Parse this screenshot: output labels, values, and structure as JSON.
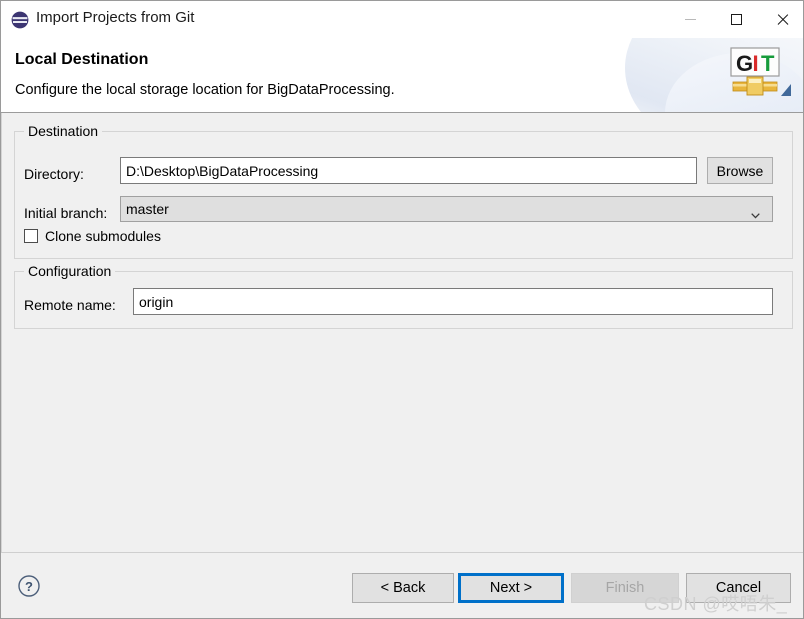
{
  "window": {
    "title": "Import Projects from Git",
    "icon": "eclipse-icon",
    "controls": {
      "minimize": "—",
      "maximize": "□",
      "close": "✕"
    }
  },
  "header": {
    "title": "Local Destination",
    "description": "Configure the local storage location for BigDataProcessing.",
    "logo_letters": [
      "G",
      "I",
      "T"
    ],
    "logo_colors": [
      "#1a1a1a",
      "#d92b2b",
      "#169b3b"
    ]
  },
  "destination": {
    "group_label": "Destination",
    "directory": {
      "label": "Directory:",
      "value": "D:\\Desktop\\BigDataProcessing",
      "placeholder": ""
    },
    "browse_button": "Browse",
    "initial_branch": {
      "label": "Initial branch:",
      "value": "master",
      "options": [
        "master"
      ]
    },
    "clone_submodules": {
      "label": "Clone submodules",
      "checked": false
    }
  },
  "configuration": {
    "group_label": "Configuration",
    "remote_name": {
      "label": "Remote name:",
      "value": "origin",
      "placeholder": ""
    }
  },
  "footer": {
    "help": "?",
    "back_button": "< Back",
    "next_button": "Next >",
    "finish_button": "Finish",
    "cancel_button": "Cancel",
    "finish_enabled": false,
    "default_button": "Next >"
  },
  "watermark": {
    "text": "CSDN @哎唔朱_"
  },
  "colors": {
    "accent": "#0070c9",
    "dialog_bg": "#f0f0f0",
    "header_bg": "#ffffff",
    "disabled_text": "#a6a6a6"
  }
}
